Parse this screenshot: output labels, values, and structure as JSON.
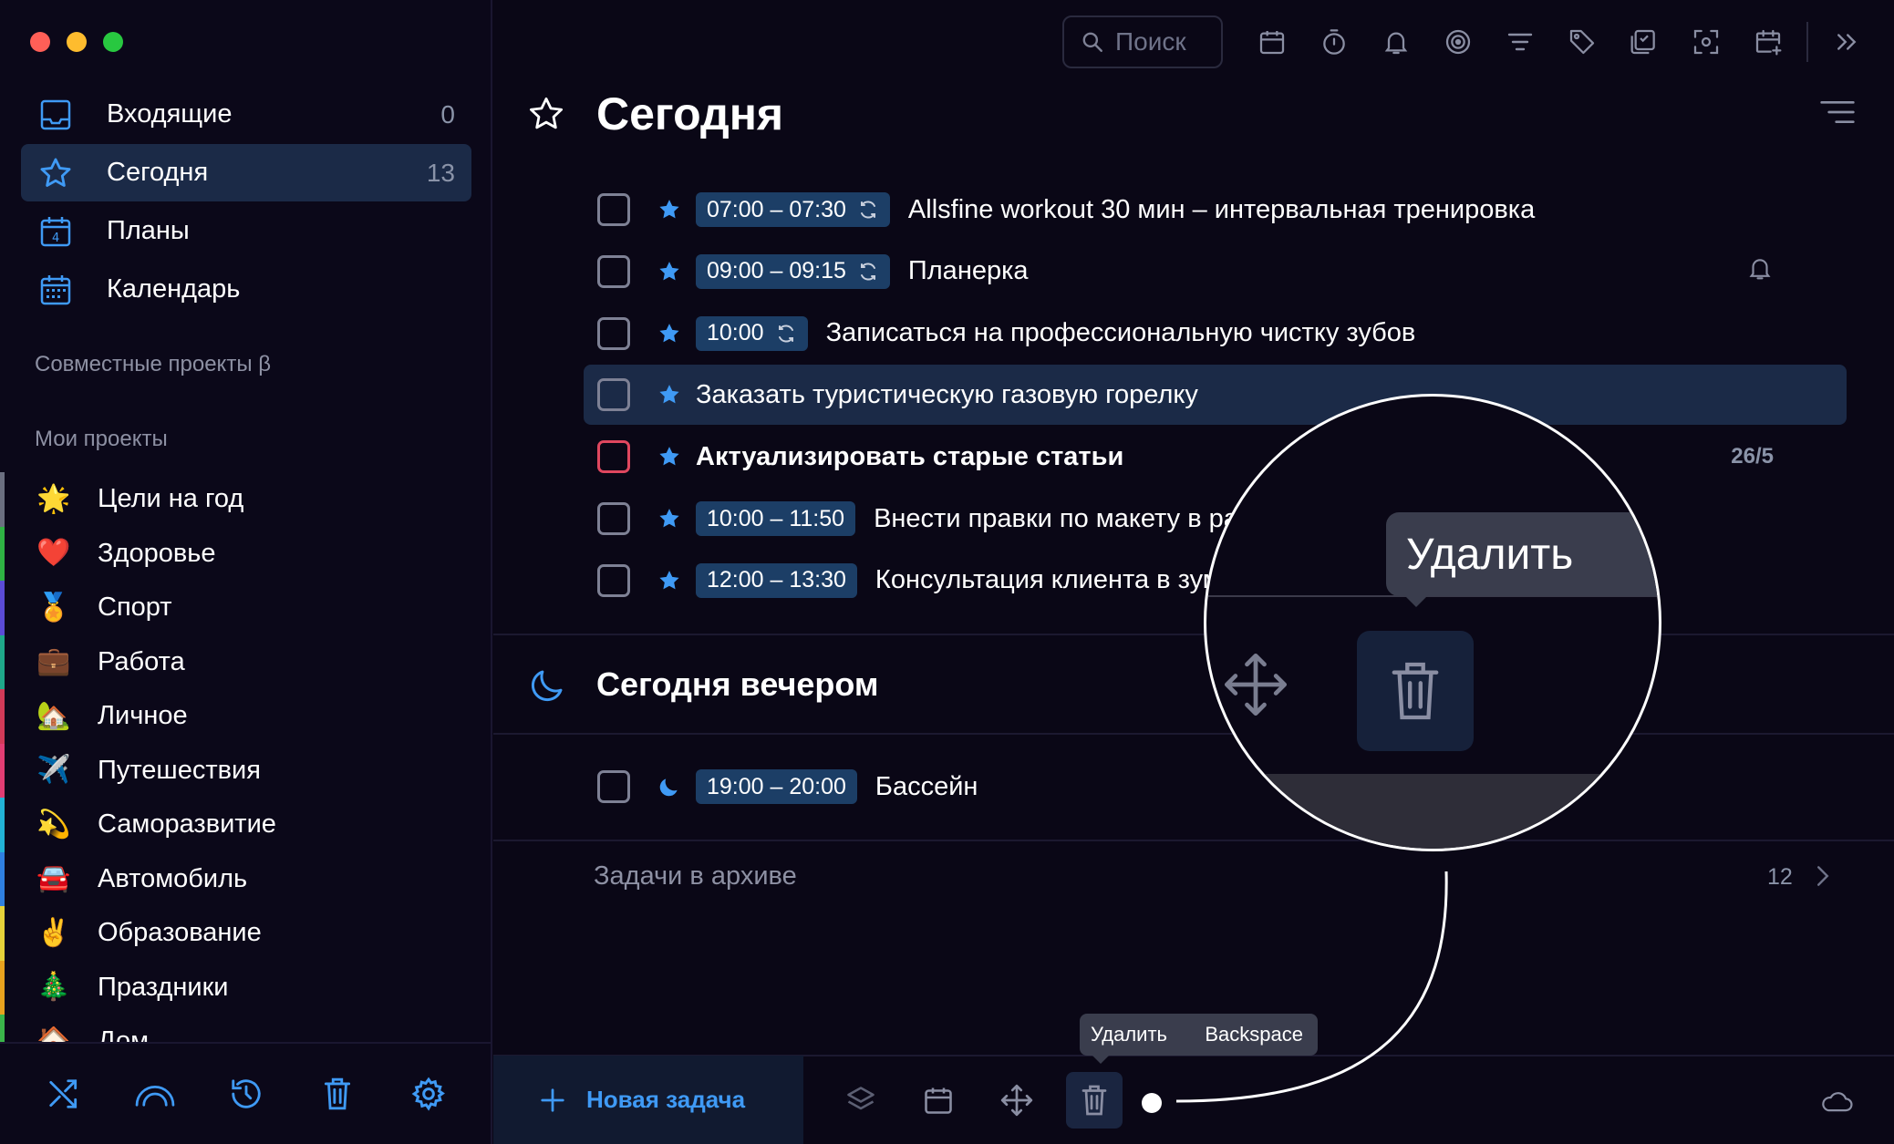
{
  "sidebar": {
    "nav": [
      {
        "label": "Входящие",
        "count": "0",
        "icon": "inbox-icon"
      },
      {
        "label": "Сегодня",
        "count": "13",
        "icon": "star-icon"
      },
      {
        "label": "Планы",
        "count": "",
        "icon": "calendar-plans-icon"
      },
      {
        "label": "Календарь",
        "count": "",
        "icon": "calendar-grid-icon"
      }
    ],
    "shared_title": "Совместные проекты β",
    "projects_title": "Мои проекты",
    "projects": [
      {
        "label": "Цели на год",
        "emoji": "🌟",
        "color": "#6b6f80"
      },
      {
        "label": "Здоровье",
        "emoji": "❤️",
        "color": "#2fb344"
      },
      {
        "label": "Спорт",
        "emoji": "🏅",
        "color": "#5b4bd6"
      },
      {
        "label": "Работа",
        "emoji": "💼",
        "color": "#1fa88a"
      },
      {
        "label": "Личное",
        "emoji": "🏡",
        "color": "#d23a58"
      },
      {
        "label": "Путешествия",
        "emoji": "✈️",
        "color": "#e23d73"
      },
      {
        "label": "Саморазвитие",
        "emoji": "💫",
        "color": "#22b3d6"
      },
      {
        "label": "Автомобиль",
        "emoji": "🚘",
        "color": "#2f7fe0"
      },
      {
        "label": "Образование",
        "emoji": "✌️",
        "color": "#e6d23a"
      },
      {
        "label": "Праздники",
        "emoji": "🎄",
        "color": "#e8a21e"
      },
      {
        "label": "Дом",
        "emoji": "🏠",
        "color": "#3bb54a"
      }
    ],
    "bottom_icons": [
      "shuffle-icon",
      "rainbow-icon",
      "history-icon",
      "trash-icon",
      "gear-icon"
    ]
  },
  "toolbar": {
    "search_placeholder": "Поиск",
    "icons": [
      "calendar-icon",
      "timer-icon",
      "bell-icon",
      "target-icon",
      "filter-icon",
      "tag-icon",
      "checklist-icon",
      "scan-icon",
      "add-calendar-icon",
      "expand-icon"
    ]
  },
  "main": {
    "title": "Сегодня",
    "tasks": [
      {
        "time": "07:00 – 07:30",
        "repeat": true,
        "text": "Allsfine workout 30 мин – интервальная тренировка",
        "right": "",
        "bell": false,
        "selected": false,
        "bold": false,
        "red": false
      },
      {
        "time": "09:00 – 09:15",
        "repeat": true,
        "text": "Планерка",
        "right": "",
        "bell": true,
        "selected": false,
        "bold": false,
        "red": false
      },
      {
        "time": "10:00",
        "repeat": true,
        "text": "Записаться на профессиональную чистку зубов",
        "right": "",
        "bell": false,
        "selected": false,
        "bold": false,
        "red": false
      },
      {
        "time": "",
        "repeat": false,
        "text": "Заказать туристическую газовую горелку",
        "right": "",
        "bell": false,
        "selected": true,
        "bold": false,
        "red": false
      },
      {
        "time": "",
        "repeat": false,
        "text": "Актуализировать старые статьи",
        "right": "26/5",
        "bell": false,
        "selected": false,
        "bold": true,
        "red": true
      },
      {
        "time": "10:00 – 11:50",
        "repeat": false,
        "text": "Внести правки по макету в раз",
        "right": "",
        "bell": false,
        "selected": false,
        "bold": false,
        "red": false
      },
      {
        "time": "12:00 – 13:30",
        "repeat": false,
        "text": "Консультация клиента в зум",
        "right": "",
        "bell": false,
        "selected": false,
        "bold": false,
        "red": false
      }
    ],
    "evening_title": "Сегодня вечером",
    "evening_tasks": [
      {
        "time": "19:00 – 20:00",
        "text": "Бассейн"
      }
    ],
    "archive_label": "Задачи в архиве",
    "archive_count": "12"
  },
  "bottom_bar": {
    "new_task_label": "Новая задача",
    "icons": [
      "layers-icon",
      "calendar-icon",
      "move-icon",
      "trash-icon"
    ],
    "tooltip_action": "Удалить",
    "tooltip_shortcut": "Backspace"
  },
  "magnifier": {
    "tooltip_text": "Удалить"
  },
  "colors": {
    "accent": "#3f9af5",
    "selected_row": "#1b2a47",
    "time_chip": "#1c3e66",
    "background": "#0a0716"
  }
}
